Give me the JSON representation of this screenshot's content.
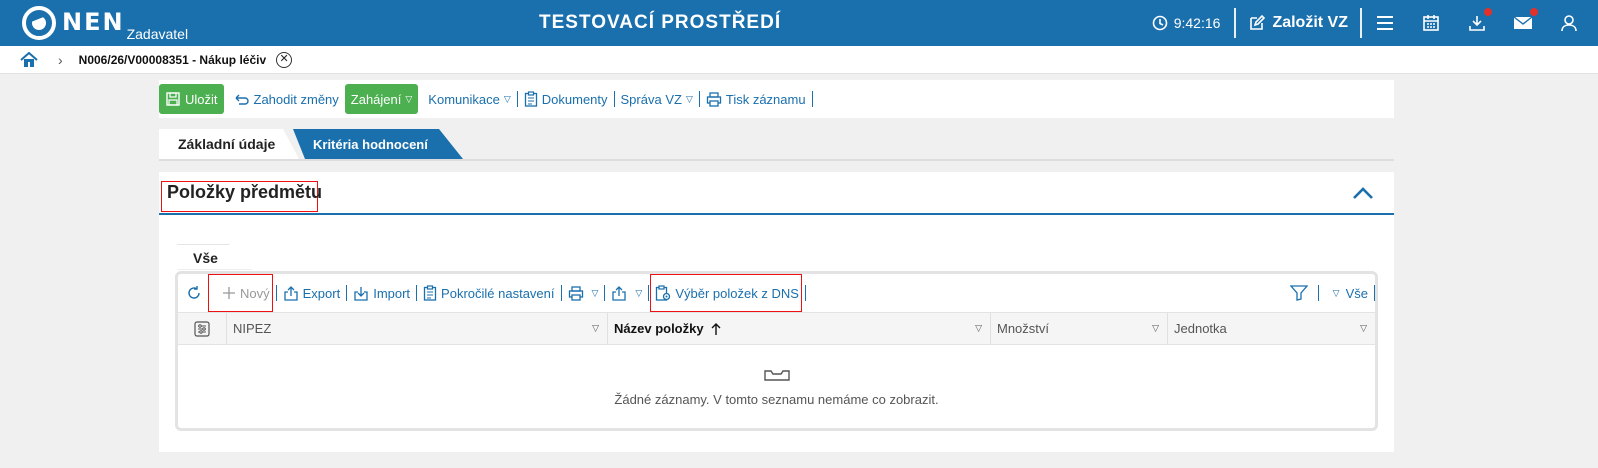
{
  "topbar": {
    "logo_text": "NEN",
    "logo_sub": "Zadavatel",
    "environment": "TESTOVACÍ PROSTŘEDÍ",
    "time": "9:42:16",
    "create_vz": "Založit VZ",
    "accent": "#1a6fad",
    "icons": [
      "clock-icon",
      "edit-icon",
      "menu-icon",
      "calendar-icon",
      "download-icon",
      "mail-icon",
      "user-icon"
    ]
  },
  "breadcrumb": {
    "text": "N006/26/V00008351 - Nákup léčiv"
  },
  "toolbar": {
    "save": "Uložit",
    "discard": "Zahodit změny",
    "start": "Zahájení",
    "communication": "Komunikace",
    "documents": "Dokumenty",
    "manage": "Správa VZ",
    "print": "Tisk záznamu"
  },
  "tabs": {
    "basic": "Základní údaje",
    "criteria": "Kritéria hodnocení"
  },
  "section": {
    "title": "Položky předmětu",
    "subtab": "Vše",
    "grid": {
      "new": "Nový",
      "export": "Export",
      "import": "Import",
      "advanced": "Pokročilé nastavení",
      "dns": "Výběr položek z DNS",
      "filter_all": "Vše",
      "columns": [
        "NIPEZ",
        "Název položky",
        "Množství",
        "Jednotka"
      ],
      "empty_text": "Žádné záznamy. V tomto seznamu nemáme co zobrazit."
    }
  }
}
